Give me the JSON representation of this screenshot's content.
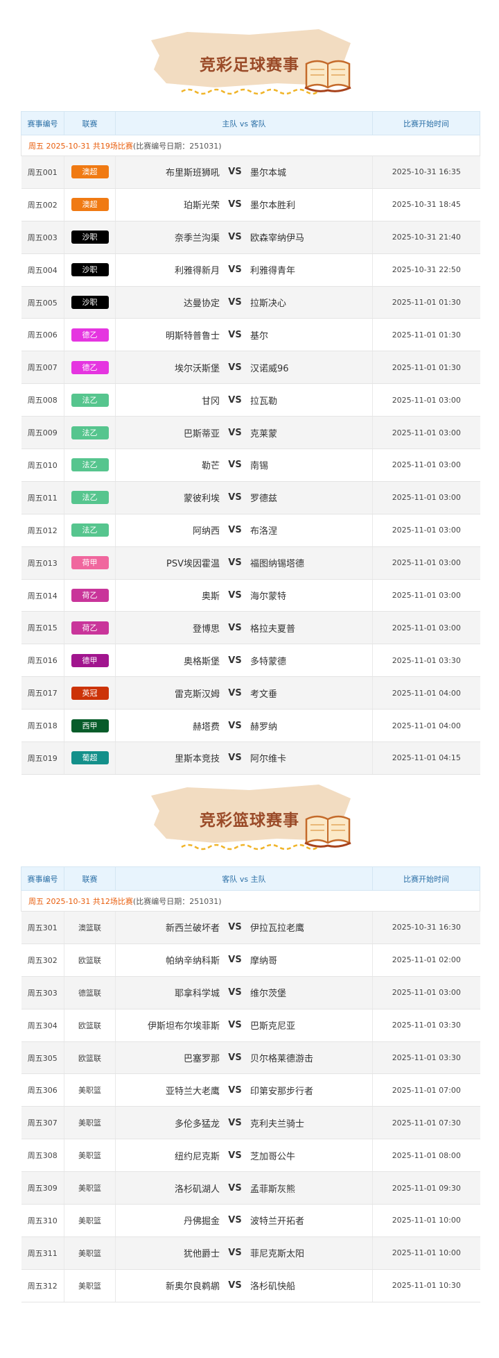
{
  "football": {
    "title": "竞彩足球赛事",
    "headers": [
      "赛事编号",
      "联赛",
      "主队 vs 客队",
      "比赛开始时间"
    ],
    "info_date": "周五 2025-10-31 共19场比赛",
    "info_code": "(比赛编号日期：251031)",
    "vs": "VS",
    "rows": [
      {
        "num": "周五001",
        "league": "澳超",
        "color": "#f07a13",
        "home": "布里斯班狮吼",
        "away": "墨尔本城",
        "time": "2025-10-31 16:35"
      },
      {
        "num": "周五002",
        "league": "澳超",
        "color": "#f07a13",
        "home": "珀斯光荣",
        "away": "墨尔本胜利",
        "time": "2025-10-31 18:45"
      },
      {
        "num": "周五003",
        "league": "沙职",
        "color": "#000000",
        "home": "奈季兰沟渠",
        "away": "欧森宰纳伊马",
        "time": "2025-10-31 21:40"
      },
      {
        "num": "周五004",
        "league": "沙职",
        "color": "#000000",
        "home": "利雅得新月",
        "away": "利雅得青年",
        "time": "2025-10-31 22:50"
      },
      {
        "num": "周五005",
        "league": "沙职",
        "color": "#000000",
        "home": "达曼协定",
        "away": "拉斯决心",
        "time": "2025-11-01 01:30"
      },
      {
        "num": "周五006",
        "league": "德乙",
        "color": "#e535e0",
        "home": "明斯特普鲁士",
        "away": "基尔",
        "time": "2025-11-01 01:30"
      },
      {
        "num": "周五007",
        "league": "德乙",
        "color": "#e535e0",
        "home": "埃尔沃斯堡",
        "away": "汉诺威96",
        "time": "2025-11-01 01:30"
      },
      {
        "num": "周五008",
        "league": "法乙",
        "color": "#56c58e",
        "home": "甘冈",
        "away": "拉瓦勒",
        "time": "2025-11-01 03:00"
      },
      {
        "num": "周五009",
        "league": "法乙",
        "color": "#56c58e",
        "home": "巴斯蒂亚",
        "away": "克莱蒙",
        "time": "2025-11-01 03:00"
      },
      {
        "num": "周五010",
        "league": "法乙",
        "color": "#56c58e",
        "home": "勒芒",
        "away": "南锡",
        "time": "2025-11-01 03:00"
      },
      {
        "num": "周五011",
        "league": "法乙",
        "color": "#56c58e",
        "home": "蒙彼利埃",
        "away": "罗德兹",
        "time": "2025-11-01 03:00"
      },
      {
        "num": "周五012",
        "league": "法乙",
        "color": "#56c58e",
        "home": "阿纳西",
        "away": "布洛涅",
        "time": "2025-11-01 03:00"
      },
      {
        "num": "周五013",
        "league": "荷甲",
        "color": "#f0679e",
        "home": "PSV埃因霍温",
        "away": "福图纳锡塔德",
        "time": "2025-11-01 03:00"
      },
      {
        "num": "周五014",
        "league": "荷乙",
        "color": "#c9359a",
        "home": "奥斯",
        "away": "海尔蒙特",
        "time": "2025-11-01 03:00"
      },
      {
        "num": "周五015",
        "league": "荷乙",
        "color": "#c9359a",
        "home": "登博思",
        "away": "格拉夫夏普",
        "time": "2025-11-01 03:00"
      },
      {
        "num": "周五016",
        "league": "德甲",
        "color": "#a1158e",
        "home": "奥格斯堡",
        "away": "多特蒙德",
        "time": "2025-11-01 03:30"
      },
      {
        "num": "周五017",
        "league": "英冠",
        "color": "#cc3308",
        "home": "雷克斯汉姆",
        "away": "考文垂",
        "time": "2025-11-01 04:00"
      },
      {
        "num": "周五018",
        "league": "西甲",
        "color": "#075c2a",
        "home": "赫塔费",
        "away": "赫罗纳",
        "time": "2025-11-01 04:00"
      },
      {
        "num": "周五019",
        "league": "葡超",
        "color": "#14908a",
        "home": "里斯本竞技",
        "away": "阿尔维卡",
        "time": "2025-11-01 04:15"
      }
    ]
  },
  "basketball": {
    "title": "竞彩篮球赛事",
    "headers": [
      "赛事编号",
      "联赛",
      "客队 vs 主队",
      "比赛开始时间"
    ],
    "info_date": "周五 2025-10-31 共12场比赛",
    "info_code": "(比赛编号日期：251031)",
    "vs": "VS",
    "rows": [
      {
        "num": "周五301",
        "league": "澳篮联",
        "home": "新西兰破坏者",
        "away": "伊拉瓦拉老鹰",
        "time": "2025-10-31 16:30"
      },
      {
        "num": "周五302",
        "league": "欧篮联",
        "home": "帕纳辛纳科斯",
        "away": "摩纳哥",
        "time": "2025-11-01 02:00"
      },
      {
        "num": "周五303",
        "league": "德篮联",
        "home": "耶拿科学城",
        "away": "维尔茨堡",
        "time": "2025-11-01 03:00"
      },
      {
        "num": "周五304",
        "league": "欧篮联",
        "home": "伊斯坦布尔埃菲斯",
        "away": "巴斯克尼亚",
        "time": "2025-11-01 03:30"
      },
      {
        "num": "周五305",
        "league": "欧篮联",
        "home": "巴塞罗那",
        "away": "贝尔格莱德游击",
        "time": "2025-11-01 03:30"
      },
      {
        "num": "周五306",
        "league": "美职篮",
        "home": "亚特兰大老鹰",
        "away": "印第安那步行者",
        "time": "2025-11-01 07:00"
      },
      {
        "num": "周五307",
        "league": "美职篮",
        "home": "多伦多猛龙",
        "away": "克利夫兰骑士",
        "time": "2025-11-01 07:30"
      },
      {
        "num": "周五308",
        "league": "美职篮",
        "home": "纽约尼克斯",
        "away": "芝加哥公牛",
        "time": "2025-11-01 08:00"
      },
      {
        "num": "周五309",
        "league": "美职篮",
        "home": "洛杉矶湖人",
        "away": "孟菲斯灰熊",
        "time": "2025-11-01 09:30"
      },
      {
        "num": "周五310",
        "league": "美职篮",
        "home": "丹佛掘金",
        "away": "波特兰开拓者",
        "time": "2025-11-01 10:00"
      },
      {
        "num": "周五311",
        "league": "美职篮",
        "home": "犹他爵士",
        "away": "菲尼克斯太阳",
        "time": "2025-11-01 10:00"
      },
      {
        "num": "周五312",
        "league": "美职篮",
        "home": "新奥尔良鹈鹕",
        "away": "洛杉矶快船",
        "time": "2025-11-01 10:30"
      }
    ]
  }
}
